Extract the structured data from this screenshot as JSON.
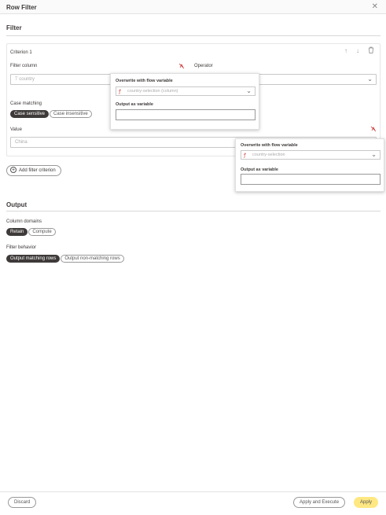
{
  "window": {
    "title": "Row Filter",
    "close_glyph": "✕"
  },
  "filter": {
    "section_title": "Filter",
    "criterion": {
      "title": "Criterion 1",
      "filter_column_label": "Filter column",
      "filter_column_value": "country",
      "operator_label": "Operator",
      "case_matching_label": "Case matching",
      "case_options": [
        "Case sensitive",
        "Case insensitive"
      ],
      "case_selected": "Case sensitive",
      "value_label": "Value",
      "value_placeholder": "China"
    },
    "popover_column": {
      "overwrite_label": "Overwrite with flow variable",
      "flow_variable": "country-selection (column)",
      "output_label": "Output as variable",
      "output_value": ""
    },
    "popover_value": {
      "overwrite_label": "Overwrite with flow variable",
      "flow_variable": "country-selection",
      "output_label": "Output as variable",
      "output_value": ""
    },
    "add_button_label": "Add filter criterion"
  },
  "output": {
    "section_title": "Output",
    "column_domains_label": "Column domains",
    "domain_options": [
      "Retain",
      "Compute"
    ],
    "domain_selected": "Retain",
    "filter_behavior_label": "Filter behavior",
    "behavior_options": [
      "Output matching rows",
      "Output non-matching rows"
    ],
    "behavior_selected": "Output matching rows"
  },
  "footer": {
    "discard_label": "Discard",
    "apply_execute_label": "Apply and Execute",
    "apply_label": "Apply"
  },
  "icons": {
    "close": "close-icon",
    "flow_variable": "flow-variable-icon",
    "arrow_up": "arrow-up-icon",
    "arrow_down": "arrow-down-icon",
    "trash": "trash-icon",
    "chevron": "chevron-down-icon",
    "plus": "plus-circle-icon"
  },
  "colors": {
    "accent_dark": "#3e3a39",
    "apply_yellow": "#ffe882",
    "flow_variable_red": "#cc3333"
  }
}
